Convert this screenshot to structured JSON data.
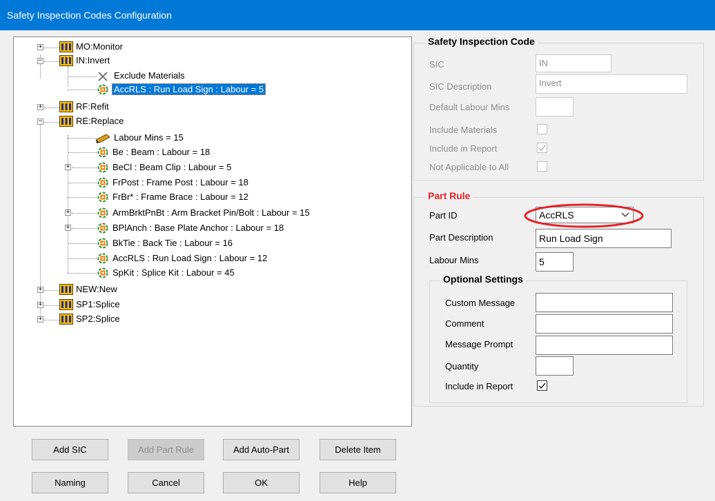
{
  "window": {
    "title": "Safety Inspection Codes Configuration"
  },
  "tree": {
    "nodes": [
      {
        "label": "MO:Monitor"
      },
      {
        "label": "IN:Invert"
      },
      {
        "label": "Exclude Materials"
      },
      {
        "label": "AccRLS : Run Load Sign : Labour = 5"
      },
      {
        "label": "RF:Refit"
      },
      {
        "label": "RE:Replace"
      },
      {
        "label": "Labour Mins = 15"
      },
      {
        "label": "Be : Beam : Labour = 18"
      },
      {
        "label": "BeCl : Beam Clip : Labour = 5"
      },
      {
        "label": "FrPost : Frame Post : Labour = 18"
      },
      {
        "label": "FrBr* : Frame Brace : Labour = 12"
      },
      {
        "label": "ArmBrktPnBt : Arm Bracket Pin/Bolt : Labour = 15"
      },
      {
        "label": "BPlAnch : Base Plate Anchor : Labour = 18"
      },
      {
        "label": "BkTie : Back Tie : Labour = 16"
      },
      {
        "label": "AccRLS : Run Load Sign : Labour = 12"
      },
      {
        "label": "SpKit : Splice Kit : Labour = 45"
      },
      {
        "label": "NEW:New"
      },
      {
        "label": "SP1:Splice"
      },
      {
        "label": "SP2:Splice"
      }
    ]
  },
  "sic_panel": {
    "title": "Safety Inspection Code",
    "sic_label": "SIC",
    "sic_value": "IN",
    "desc_label": "SIC Description",
    "desc_value": "Invert",
    "labour_label": "Default Labour Mins",
    "labour_value": "",
    "include_materials_label": "Include Materials",
    "include_report_label": "Include in Report",
    "not_applicable_label": "Not Applicable to All"
  },
  "part_rule": {
    "title": "Part Rule",
    "part_id_label": "Part ID",
    "part_id_value": "AccRLS",
    "part_desc_label": "Part Description",
    "part_desc_value": "Run Load Sign",
    "labour_label": "Labour Mins",
    "labour_value": "5",
    "optional": {
      "title": "Optional Settings",
      "custom_message_label": "Custom Message",
      "comment_label": "Comment",
      "message_prompt_label": "Message Prompt",
      "quantity_label": "Quantity",
      "include_report_label": "Include in Report"
    }
  },
  "buttons": {
    "add_sic": "Add SIC",
    "add_part_rule": "Add Part Rule",
    "add_auto_part": "Add Auto-Part",
    "delete_item": "Delete Item",
    "naming": "Naming",
    "cancel": "Cancel",
    "ok": "OK",
    "help": "Help"
  },
  "icons": {
    "sic": "grid-icon",
    "part": "part-icon",
    "exclude": "x-icon",
    "labour": "pencil-icon"
  },
  "colors": {
    "titlebar": "#0078d7",
    "selection": "#0078d7",
    "part_rule_title": "#e0242a",
    "highlight_ellipse": "#e0242a"
  }
}
